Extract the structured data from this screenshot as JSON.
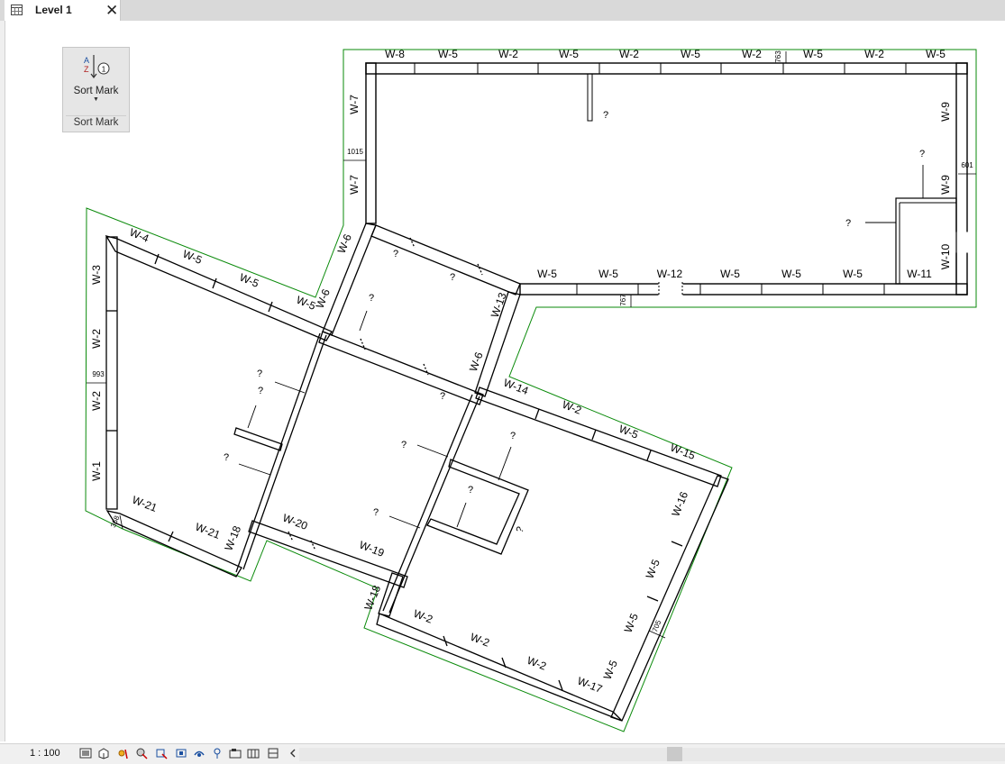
{
  "tab": {
    "title": "Level 1",
    "close_icon": "close-icon",
    "view_icon": "floor-plan-icon"
  },
  "ribbon_panel": {
    "button_label": "Sort Mark",
    "button_icon": "sort-az-icon",
    "dropdown_icon": "chevron-down-icon",
    "panel_title": "Sort Mark",
    "badge": "1"
  },
  "drawing": {
    "tags": [
      "W-8",
      "W-5",
      "W-2",
      "W-5",
      "W-2",
      "W-5",
      "W-2",
      "W-5",
      "W-2",
      "W-5",
      "W-7",
      "W-7",
      "W-9",
      "W-9",
      "W-10",
      "W-5",
      "W-5",
      "W-12",
      "W-5",
      "W-5",
      "W-5",
      "W-11",
      "W-4",
      "W-5",
      "W-5",
      "W-5",
      "W-6",
      "W-6",
      "W-3",
      "W-2",
      "W-2",
      "W-1",
      "W-13",
      "W-6",
      "W-14",
      "W-2",
      "W-5",
      "W-15",
      "W-16",
      "W-5",
      "W-5",
      "W-5",
      "W-17",
      "W-2",
      "W-2",
      "W-2",
      "W-18",
      "W-19",
      "W-20",
      "W-18",
      "W-21",
      "W-21"
    ],
    "dimensions": [
      "763",
      "1015",
      "601",
      "767",
      "993",
      "368",
      "705"
    ],
    "unknown_mark": "?"
  },
  "status_bar": {
    "scale": "1 : 100",
    "icons": [
      "detail-level-icon",
      "visual-style-icon",
      "sun-path-icon",
      "shadows-icon",
      "crop-view-icon",
      "show-crop-icon",
      "unlock-3d-icon",
      "temporary-hide-icon",
      "reveal-hidden-icon",
      "worksharing-icon",
      "analytical-model-icon",
      "constraints-icon",
      "scroll-left-icon"
    ]
  },
  "colors": {
    "boundary": "#0a8a0a",
    "wall": "#000000",
    "tab_bar": "#d9d9d9",
    "panel": "#e6e6e6"
  }
}
